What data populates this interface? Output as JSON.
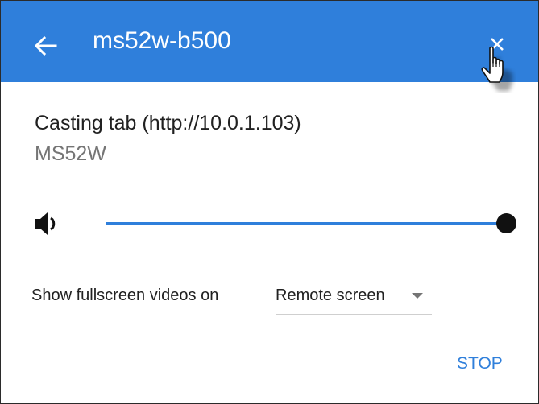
{
  "header": {
    "title": "ms52w-b500",
    "back_icon": "arrow-left-icon",
    "close_icon": "close-icon",
    "background_color": "#2f7fdb"
  },
  "cast": {
    "title": "Casting tab (http://10.0.1.103)",
    "device_name": "MS52W"
  },
  "volume": {
    "icon": "volume-icon",
    "level": 1.0,
    "accent_color": "#2f7fdb"
  },
  "fullscreen": {
    "label": "Show fullscreen videos on",
    "selected": "Remote screen"
  },
  "actions": {
    "stop_label": "STOP"
  }
}
